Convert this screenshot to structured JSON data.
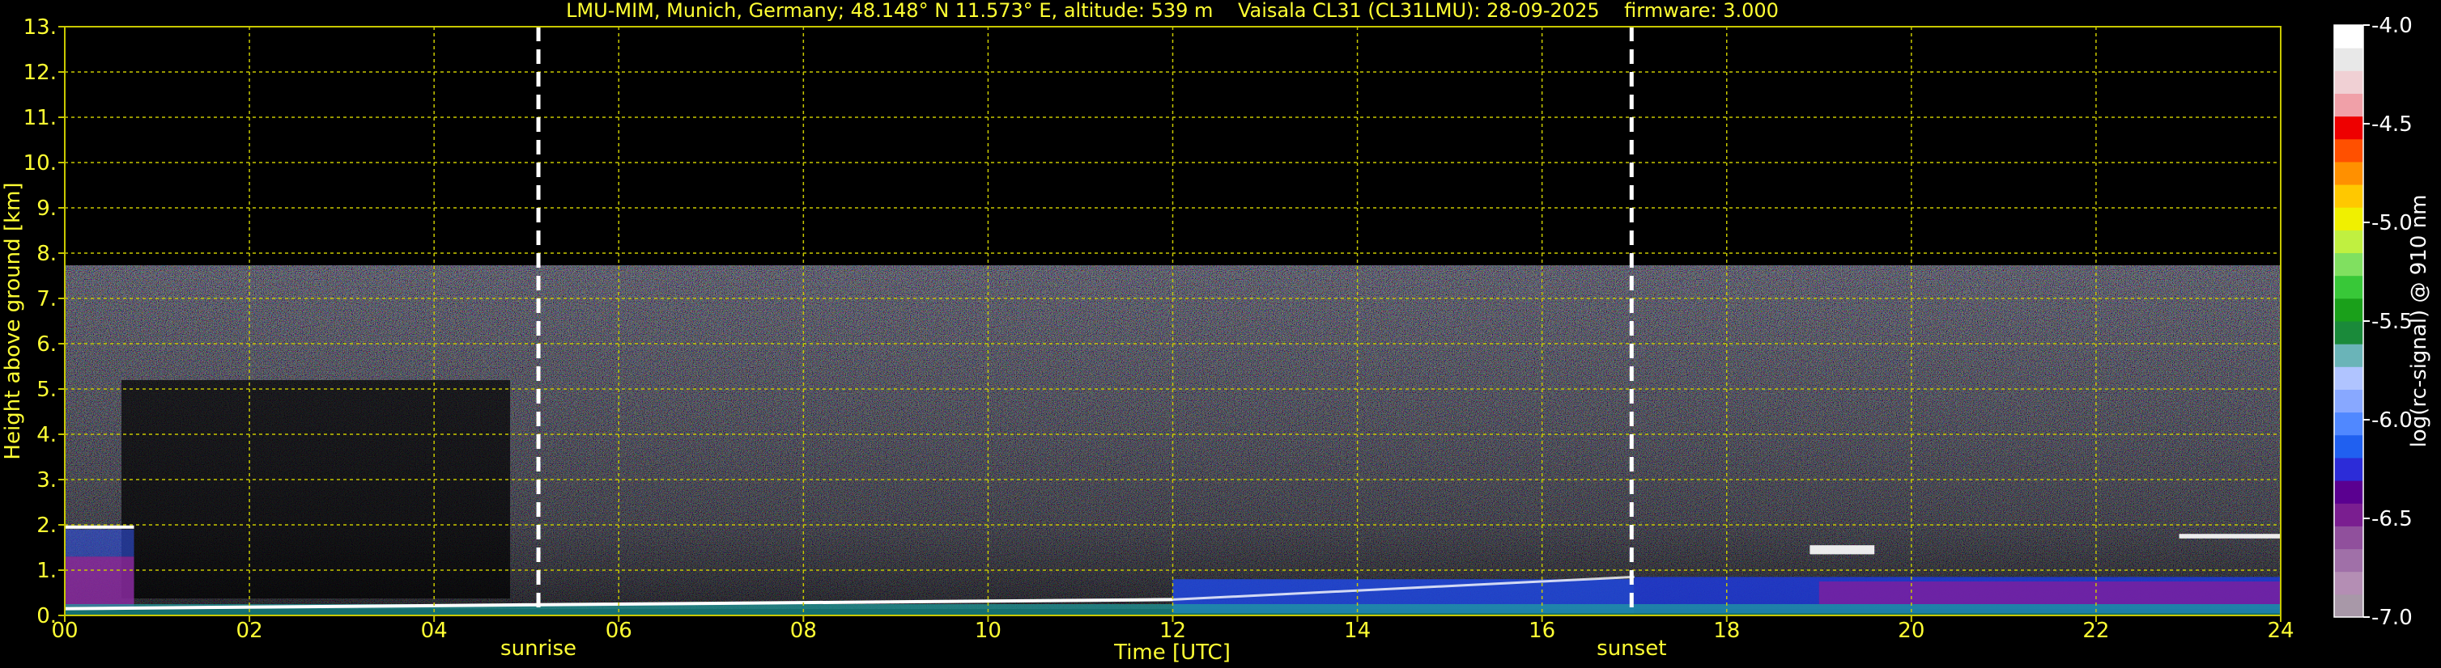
{
  "chart_data": {
    "type": "heatmap",
    "title": "LMU-MIM, Munich, Germany; 48.148° N 11.573° E, altitude: 539 m    Vaisala CL31 (CL31LMU): 28-09-2025    firmware: 3.000",
    "xlabel": "Time [UTC]",
    "ylabel": "Height above ground [km]",
    "xlim": [
      0,
      24
    ],
    "ylim": [
      0,
      13
    ],
    "x_ticks": [
      "00",
      "02",
      "04",
      "06",
      "08",
      "10",
      "12",
      "14",
      "16",
      "18",
      "20",
      "22",
      "24"
    ],
    "y_ticks": [
      "0.",
      "1.",
      "2.",
      "3.",
      "4.",
      "5.",
      "6.",
      "7.",
      "8.",
      "9.",
      "10.",
      "11.",
      "12.",
      "13."
    ],
    "grid": true,
    "markers": [
      {
        "label": "sunrise",
        "x": 5.13
      },
      {
        "label": "sunset",
        "x": 16.97
      }
    ],
    "colorbar": {
      "label": "log(rc-signal) @ 910 nm",
      "range": [
        -7.0,
        -4.0
      ],
      "ticks": [
        "-4.0",
        "-4.5",
        "-5.0",
        "-5.5",
        "-6.0",
        "-6.5",
        "-7.0"
      ],
      "colors": [
        "#a898a8",
        "#b48eb4",
        "#a070a8",
        "#90509c",
        "#7a1e90",
        "#5a0090",
        "#2c2cd8",
        "#2060f0",
        "#5088ff",
        "#88a8ff",
        "#b0c4ff",
        "#6ab4b8",
        "#1a8a3a",
        "#1aa01a",
        "#38c838",
        "#80e060",
        "#c0f040",
        "#f0f000",
        "#ffc800",
        "#ff9000",
        "#ff5000",
        "#ee0000",
        "#f0a0a8",
        "#f0d0d4",
        "#e8e8e8",
        "#ffffff"
      ]
    },
    "features": [
      {
        "label": "noise-region",
        "height_km": [
          0.3,
          7.75
        ]
      },
      {
        "label": "boundary-layer",
        "x": [
          0,
          24
        ],
        "height_km": [
          0.15,
          0.9
        ]
      },
      {
        "label": "aerosol-layer-night",
        "x": [
          0,
          0.75
        ],
        "height_km": [
          0.2,
          1.9
        ]
      },
      {
        "label": "cloud-layer-evening",
        "x": [
          18.9,
          19.6
        ],
        "height_km": [
          1.35,
          1.55
        ]
      },
      {
        "label": "cloud-layer-late",
        "x": [
          22.9,
          24
        ],
        "height_km": [
          1.7,
          1.8
        ]
      }
    ],
    "colors": {
      "text": "#ffff33",
      "grid": "#c8c800",
      "marker": "#ffffff",
      "background": "#000000"
    }
  }
}
